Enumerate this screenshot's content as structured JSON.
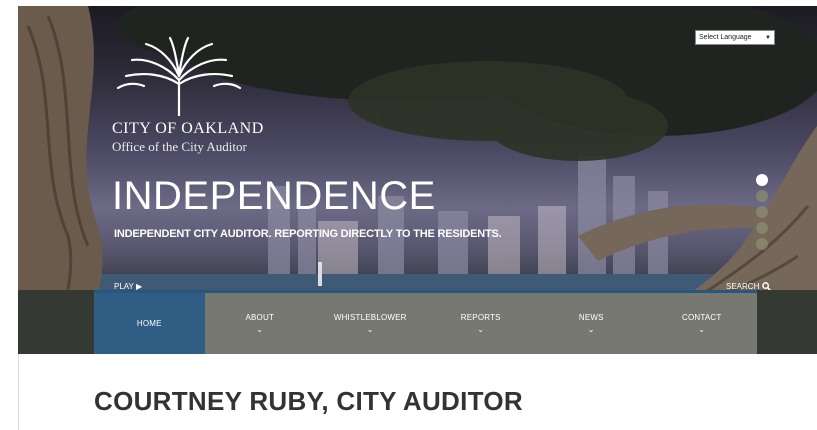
{
  "language_select": {
    "label": "Select Language"
  },
  "logo": {
    "city": "CITY OF OAKLAND",
    "office": "Office of the City Auditor"
  },
  "hero": {
    "title": "INDEPENDENCE",
    "subtitle": "INDEPENDENT CITY AUDITOR. REPORTING DIRECTLY TO THE RESIDENTS.",
    "play_label": "PLAY ▶",
    "search_label": "SEARCH",
    "slides": {
      "count": 5,
      "active_index": 0
    }
  },
  "nav": {
    "items": [
      {
        "label": "HOME",
        "has_dropdown": false,
        "active": true
      },
      {
        "label": "ABOUT",
        "has_dropdown": true
      },
      {
        "label": "WHISTLEBLOWER",
        "has_dropdown": true
      },
      {
        "label": "REPORTS",
        "has_dropdown": true
      },
      {
        "label": "NEWS",
        "has_dropdown": true
      },
      {
        "label": "CONTACT",
        "has_dropdown": true
      }
    ]
  },
  "main": {
    "heading": "COURTNEY RUBY, CITY AUDITOR"
  },
  "colors": {
    "nav_active": "#2f5d84",
    "nav_bg": "#777872",
    "nav_border": "#28577e"
  }
}
